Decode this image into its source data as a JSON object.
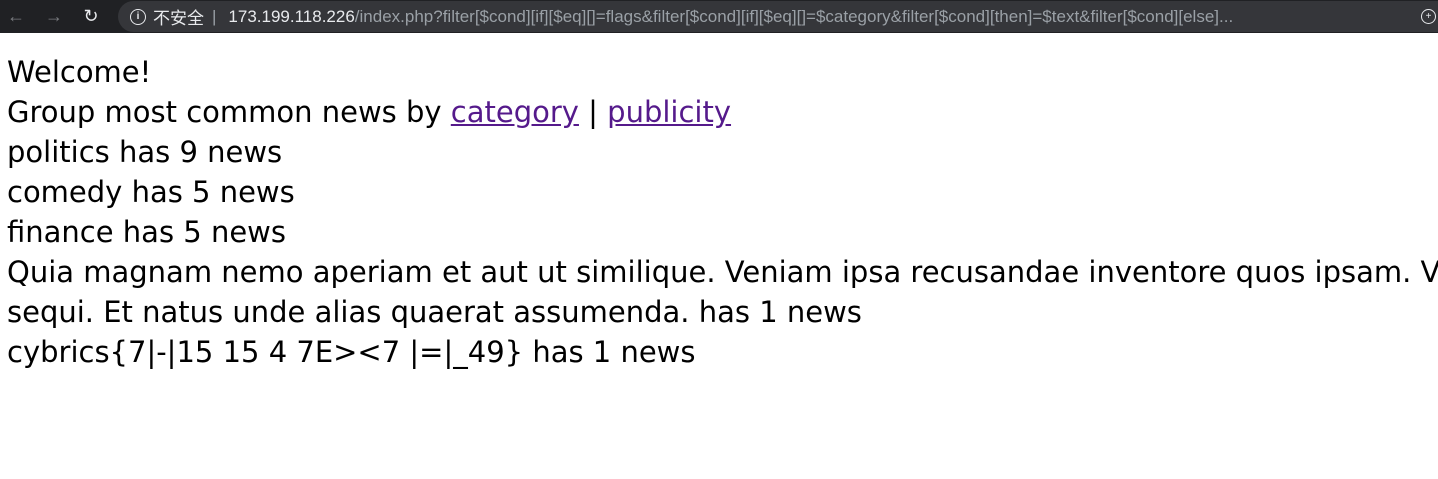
{
  "browser": {
    "security_label": "不安全",
    "separator": "|",
    "url_host": "173.199.118.226",
    "url_path": "/index.php?filter[$cond][if][$eq][]=flags&filter[$cond][if][$eq][]=$category&filter[$cond][then]=$text&filter[$cond][else]..."
  },
  "page": {
    "welcome": "Welcome!",
    "group_prefix": "Group most common news by ",
    "group_link_category": "category",
    "group_separator": " | ",
    "group_link_publicity": "publicity",
    "results": [
      "politics has 9 news",
      "comedy has 5 news",
      "finance has 5 news",
      "Quia magnam nemo aperiam et aut ut similique. Veniam ipsa recusandae inventore quos ipsam. Vel",
      "sequi. Et natus unde alias quaerat assumenda. has 1 news",
      "cybrics{7|-|15 15 4 7E><7 |=|_49} has 1 news"
    ]
  }
}
